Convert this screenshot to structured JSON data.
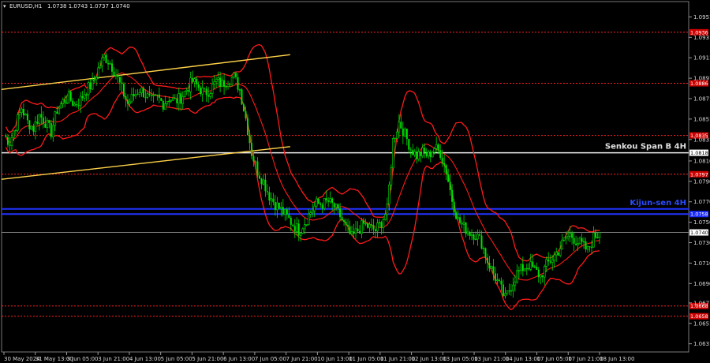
{
  "header": {
    "symbol": "EURUSD,H1",
    "ohlc": "1.0738 1.0743 1.0737 1.0740"
  },
  "chart_data": {
    "type": "candlestick",
    "title": "EURUSD,H1",
    "y_ticks": [
      1.0951,
      1.0931,
      1.0911,
      1.0891,
      1.0871,
      1.0851,
      1.0831,
      1.081,
      1.079,
      1.077,
      1.075,
      1.073,
      1.071,
      1.069,
      1.0671,
      1.0651,
      1.0631
    ],
    "ylim": [
      1.0623,
      1.0966
    ],
    "x_ticks": [
      "30 May 2024",
      "31 May 13:00",
      "3 Jun 05:00",
      "3 Jun 21:00",
      "4 Jun 13:00",
      "5 Jun 05:00",
      "5 Jun 21:00",
      "6 Jun 13:00",
      "7 Jun 05:00",
      "7 Jun 21:00",
      "10 Jun 13:00",
      "11 Jun 05:00",
      "11 Jun 21:00",
      "12 Jun 13:00",
      "13 Jun 05:00",
      "13 Jun 21:00",
      "14 Jun 13:00",
      "17 Jun 05:00",
      "17 Jun 21:00",
      "18 Jun 13:00"
    ],
    "levels": [
      {
        "value": 1.0936,
        "label": "1.0936",
        "style": "red-dotted"
      },
      {
        "value": 1.0886,
        "label": "1.0886",
        "style": "red-dotted"
      },
      {
        "value": 1.0835,
        "label": "1.0835",
        "style": "red-dotted"
      },
      {
        "value": 1.0818,
        "label": "1.0818",
        "style": "white-solid",
        "name": "Senkou Span B 4H"
      },
      {
        "value": 1.0797,
        "label": "1.0797",
        "style": "red-dotted"
      },
      {
        "value": 1.0763,
        "label": "",
        "style": "blue-solid",
        "name": "Kijun-sen 4H"
      },
      {
        "value": 1.0758,
        "label": "1.0758",
        "style": "blue-solid"
      },
      {
        "value": 1.074,
        "label": "1.0740",
        "style": "current"
      },
      {
        "value": 1.0668,
        "label": "1.0668",
        "style": "red-dotted"
      },
      {
        "value": 1.0658,
        "label": "1.0658",
        "style": "red-dotted"
      }
    ],
    "price_path": [
      1.0835,
      1.0828,
      1.0845,
      1.0862,
      1.0848,
      1.0842,
      1.0855,
      1.0848,
      1.0838,
      1.086,
      1.0868,
      1.0872,
      1.0865,
      1.087,
      1.088,
      1.0885,
      1.09,
      1.0912,
      1.0906,
      1.0895,
      1.088,
      1.0866,
      1.0874,
      1.088,
      1.0875,
      1.0868,
      1.0872,
      1.0866,
      1.0872,
      1.0868,
      1.0872,
      1.088,
      1.0888,
      1.0882,
      1.0876,
      1.088,
      1.0888,
      1.0885,
      1.089,
      1.0892,
      1.088,
      1.0852,
      1.0818,
      1.08,
      1.079,
      1.0776,
      1.0768,
      1.0762,
      1.0755,
      1.0748,
      1.0742,
      1.075,
      1.076,
      1.0768,
      1.0768,
      1.077,
      1.0765,
      1.0756,
      1.0744,
      1.0735,
      1.0742,
      1.0748,
      1.0745,
      1.0742,
      1.075,
      1.0762,
      1.083,
      1.0848,
      1.0836,
      1.0822,
      1.0815,
      1.0818,
      1.0815,
      1.0823,
      1.0818,
      1.08,
      1.0772,
      1.0752,
      1.0745,
      1.074,
      1.0738,
      1.073,
      1.0712,
      1.07,
      1.0688,
      1.0675,
      1.0688,
      1.07,
      1.0705,
      1.0708,
      1.0703,
      1.0697,
      1.0708,
      1.0715,
      1.0722,
      1.0732,
      1.0738,
      1.0732,
      1.0728,
      1.0722,
      1.0735,
      1.074
    ],
    "channel": [
      {
        "x0": 0.0,
        "y0": 1.088,
        "x1": 0.42,
        "y1": 1.0914
      },
      {
        "x0": 0.0,
        "y0": 1.0792,
        "x1": 0.42,
        "y1": 1.0824
      }
    ],
    "annotations": [
      {
        "text": "Senkou Span B 4H",
        "color": "#e0e0e0",
        "value": 1.0818
      },
      {
        "text": "Kijun-sen 4H",
        "color": "#2a4bff",
        "value": 1.0763
      }
    ],
    "colors": {
      "bull": "#00e000",
      "bear": "#00e000",
      "bands": "#ff1a1a",
      "channel": "#ffd24a",
      "grid": "#000000",
      "background": "#000000"
    }
  }
}
